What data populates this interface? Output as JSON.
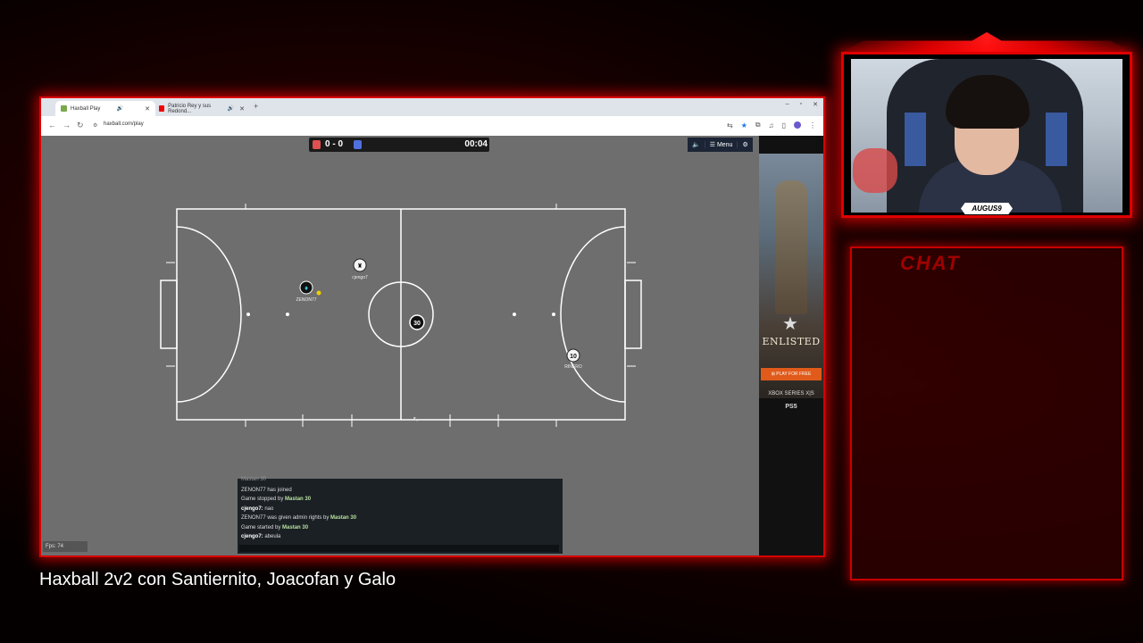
{
  "browser": {
    "tabs": [
      {
        "label": "Haxball Play",
        "active": true
      },
      {
        "label": "Patricio Rey y sus Redond...",
        "active": false
      }
    ],
    "url": "haxball.com/play"
  },
  "game": {
    "score_red": "0",
    "score_sep": "-",
    "score_blue": "0",
    "time": "00:04",
    "menu_label": "☰ Menu",
    "players": [
      {
        "name": "ZENON77",
        "team": "red",
        "avatar": "diamond"
      },
      {
        "name": "cjengo7",
        "team": "red",
        "avatar": "hat"
      },
      {
        "name": "",
        "team": "blue",
        "avatar": "30"
      },
      {
        "name": "RINERO",
        "team": "blue",
        "avatar": "10"
      }
    ],
    "chat": [
      {
        "text": "Mastan 30"
      },
      {
        "text": "ZENON77 has joined"
      },
      {
        "text": "Game stopped by ",
        "bold": "Mastan 30"
      },
      {
        "bold": "cjengo7:",
        "text": " nao"
      },
      {
        "text": "ZENON77 was given admin rights by ",
        "bold": "Mastan 30"
      },
      {
        "text": "Game started by ",
        "bold": "Mastan 30"
      },
      {
        "bold": "cjengo7:",
        "text": " abeula"
      }
    ],
    "fps": "Fps: 74"
  },
  "ad": {
    "title": "ENLISTED",
    "cta": "PLAY FOR FREE",
    "platform1": "XBOX SERIES X|S",
    "platform2": "PS5"
  },
  "webcam": {
    "name": "AUGUS9"
  },
  "chat_panel": {
    "title": "CHAT"
  },
  "caption": "Haxball 2v2 con Santiernito, Joacofan y Galo",
  "colors": {
    "accent": "#e00000",
    "pitch_line": "#ffffff",
    "red_team": "#e05050",
    "blue_team": "#5070e0"
  }
}
